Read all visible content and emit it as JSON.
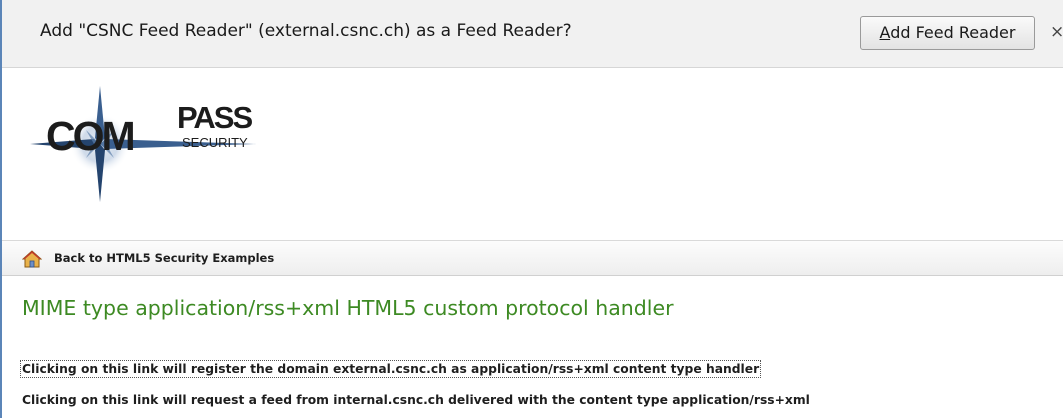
{
  "notification_bar": {
    "message": "Add \"CSNC Feed Reader\" (external.csnc.ch) as a Feed Reader?",
    "button_accel": "A",
    "button_rest": "dd Feed Reader",
    "close_glyph": "×"
  },
  "logo": {
    "main": "COM",
    "pass": "PASS",
    "sub": "SECURITY"
  },
  "nav": {
    "back_link": "Back to HTML5 Security Examples",
    "home_icon": "home-icon"
  },
  "page": {
    "heading": "MIME type application/rss+xml HTML5 custom protocol handler",
    "links": [
      "Clicking on this link will register the domain external.csnc.ch as application/rss+xml content type handler",
      "Clicking on this link will request a feed from internal.csnc.ch delivered with the content type application/rss+xml"
    ]
  },
  "colors": {
    "heading_green": "#3d8a23",
    "notification_bg": "#f1f1f1",
    "window_border": "#5b85b8",
    "logo_star": "#3a5f8f"
  }
}
